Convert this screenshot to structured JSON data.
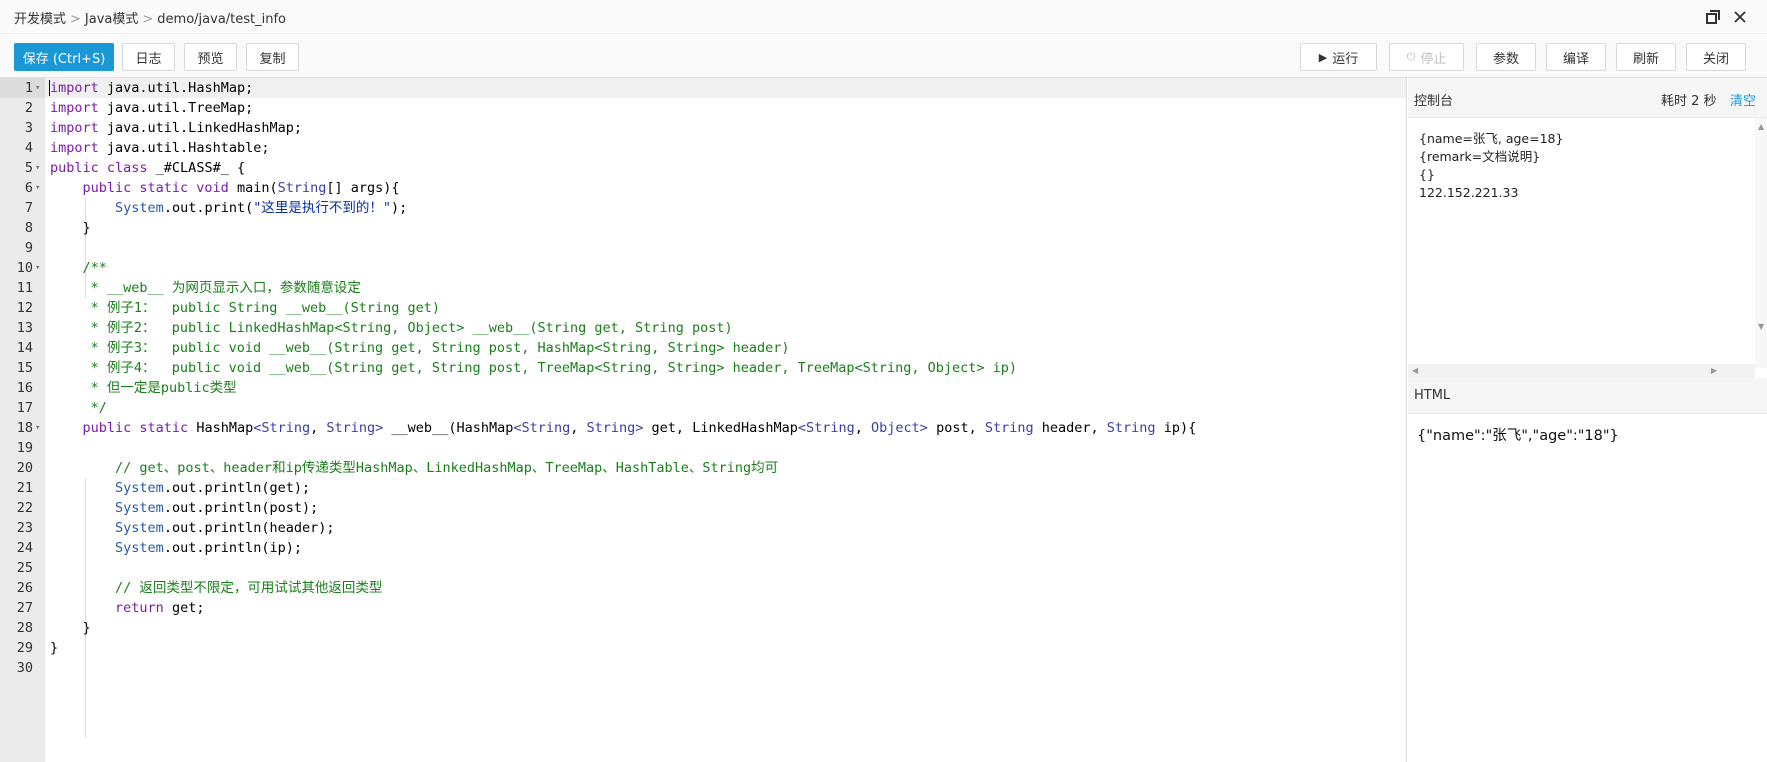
{
  "breadcrumb": {
    "items": [
      "开发模式",
      "Java模式",
      "demo/java/test_info"
    ],
    "separator": ">"
  },
  "toolbar": {
    "save": "保存 (Ctrl+S)",
    "log": "日志",
    "preview": "预览",
    "copy": "复制",
    "run": "运行",
    "stop": "停止",
    "params": "参数",
    "compile": "编译",
    "refresh": "刷新",
    "close": "关闭"
  },
  "editor": {
    "lines": [
      {
        "n": "1",
        "fold": true,
        "html": "<span class='kw'>import</span> java.util.HashMap;"
      },
      {
        "n": "2",
        "html": "<span class='kw'>import</span> java.util.TreeMap;"
      },
      {
        "n": "3",
        "html": "<span class='kw'>import</span> java.util.LinkedHashMap;"
      },
      {
        "n": "4",
        "html": "<span class='kw'>import</span> java.util.Hashtable;"
      },
      {
        "n": "5",
        "fold": true,
        "html": "<span class='kw'>public class</span> _#CLASS#_ {"
      },
      {
        "n": "6",
        "fold": true,
        "html": "    <span class='kw'>public static void</span> main(<span class='type'>String</span>[] args){"
      },
      {
        "n": "7",
        "html": "        <span class='sys'>System</span>.out.print(<span class='str'>\"这里是执行不到的！\"</span>);"
      },
      {
        "n": "8",
        "html": "    }"
      },
      {
        "n": "9",
        "html": ""
      },
      {
        "n": "10",
        "fold": true,
        "html": "    <span class='cm'>/**</span>"
      },
      {
        "n": "11",
        "html": "<span class='cm'>     * __web__ 为网页显示入口，参数随意设定</span>"
      },
      {
        "n": "12",
        "html": "<span class='cm'>     * 例子1：  public String __web__(String get)</span>"
      },
      {
        "n": "13",
        "html": "<span class='cm'>     * 例子2：  public LinkedHashMap&lt;String, Object&gt; __web__(String get, String post)</span>"
      },
      {
        "n": "14",
        "html": "<span class='cm'>     * 例子3：  public void __web__(String get, String post, HashMap&lt;String, String&gt; header)</span>"
      },
      {
        "n": "15",
        "html": "<span class='cm'>     * 例子4：  public void __web__(String get, String post, TreeMap&lt;String, String&gt; header, TreeMap&lt;String, Object&gt; ip)</span>"
      },
      {
        "n": "16",
        "html": "<span class='cm'>     * 但一定是public类型</span>"
      },
      {
        "n": "17",
        "html": "<span class='cm'>     */</span>"
      },
      {
        "n": "18",
        "fold": true,
        "html": "    <span class='kw'>public static</span> HashMap<span class='type'>&lt;String</span>, <span class='type'>String&gt;</span> __web__(HashMap<span class='type'>&lt;String</span>, <span class='type'>String&gt;</span> get, LinkedHashMap<span class='type'>&lt;String</span>, <span class='type'>Object&gt;</span> post, <span class='type'>String</span> header, <span class='type'>String</span> ip){"
      },
      {
        "n": "19",
        "html": ""
      },
      {
        "n": "20",
        "html": "<span class='cm'>        // get、post、header和ip传递类型HashMap、LinkedHashMap、TreeMap、HashTable、String均可</span>"
      },
      {
        "n": "21",
        "html": "        <span class='sys'>System</span>.out.println(get);"
      },
      {
        "n": "22",
        "html": "        <span class='sys'>System</span>.out.println(post);"
      },
      {
        "n": "23",
        "html": "        <span class='sys'>System</span>.out.println(header);"
      },
      {
        "n": "24",
        "html": "        <span class='sys'>System</span>.out.println(ip);"
      },
      {
        "n": "25",
        "html": ""
      },
      {
        "n": "26",
        "html": "<span class='cm'>        // 返回类型不限定，可用试试其他返回类型</span>"
      },
      {
        "n": "27",
        "html": "        <span class='kw'>return</span> get;"
      },
      {
        "n": "28",
        "html": "    }"
      },
      {
        "n": "29",
        "html": "}"
      },
      {
        "n": "30",
        "html": ""
      }
    ]
  },
  "console": {
    "title": "控制台",
    "elapsed": "耗时 2 秒",
    "clear": "清空",
    "output": [
      "{name=张飞, age=18}",
      "{remark=文档说明}",
      "{}",
      "122.152.221.33"
    ]
  },
  "html_panel": {
    "title": "HTML",
    "output": "{\"name\":\"张飞\",\"age\":\"18\"}"
  }
}
